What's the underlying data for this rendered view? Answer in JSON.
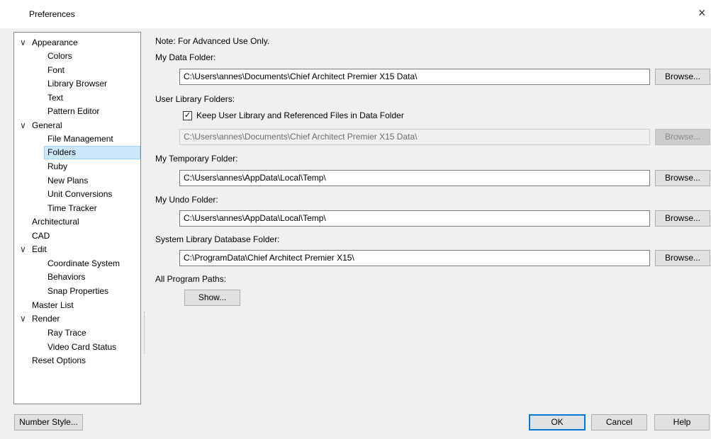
{
  "window": {
    "title": "Preferences",
    "close_glyph": "×"
  },
  "tree": {
    "items": [
      {
        "label": "Appearance",
        "expanded": true
      },
      {
        "label": "Colors"
      },
      {
        "label": "Font"
      },
      {
        "label": "Library Browser"
      },
      {
        "label": "Text"
      },
      {
        "label": "Pattern Editor"
      },
      {
        "label": "General",
        "expanded": true
      },
      {
        "label": "File Management"
      },
      {
        "label": "Folders",
        "selected": true
      },
      {
        "label": "Ruby"
      },
      {
        "label": "New Plans"
      },
      {
        "label": "Unit Conversions"
      },
      {
        "label": "Time Tracker"
      },
      {
        "label": "Architectural"
      },
      {
        "label": "CAD"
      },
      {
        "label": "Edit",
        "expanded": true
      },
      {
        "label": "Coordinate System"
      },
      {
        "label": "Behaviors"
      },
      {
        "label": "Snap Properties"
      },
      {
        "label": "Master List"
      },
      {
        "label": "Render",
        "expanded": true
      },
      {
        "label": "Ray Trace"
      },
      {
        "label": "Video Card Status"
      },
      {
        "label": "Reset Options"
      }
    ]
  },
  "panel": {
    "note": "Note: For Advanced Use Only.",
    "my_data_folder": {
      "label": "My Data Folder:",
      "value": "C:\\Users\\annes\\Documents\\Chief Architect Premier X15 Data\\",
      "browse": "Browse..."
    },
    "user_library": {
      "label": "User Library Folders:",
      "checkbox_label": "Keep User Library and Referenced Files in Data Folder",
      "checked": true,
      "value": "C:\\Users\\annes\\Documents\\Chief Architect Premier X15 Data\\",
      "browse": "Browse..."
    },
    "temp_folder": {
      "label": "My Temporary Folder:",
      "value": "C:\\Users\\annes\\AppData\\Local\\Temp\\",
      "browse": "Browse..."
    },
    "undo_folder": {
      "label": "My Undo Folder:",
      "value": "C:\\Users\\annes\\AppData\\Local\\Temp\\",
      "browse": "Browse..."
    },
    "system_library": {
      "label": "System Library Database Folder:",
      "value": "C:\\ProgramData\\Chief Architect Premier X15\\",
      "browse": "Browse..."
    },
    "program_paths": {
      "label": "All Program Paths:",
      "show": "Show..."
    }
  },
  "footer": {
    "number_style": "Number Style...",
    "ok": "OK",
    "cancel": "Cancel",
    "help": "Help"
  },
  "colors": {
    "selection": "#cce8ff",
    "default_button_border": "#0078d7"
  }
}
